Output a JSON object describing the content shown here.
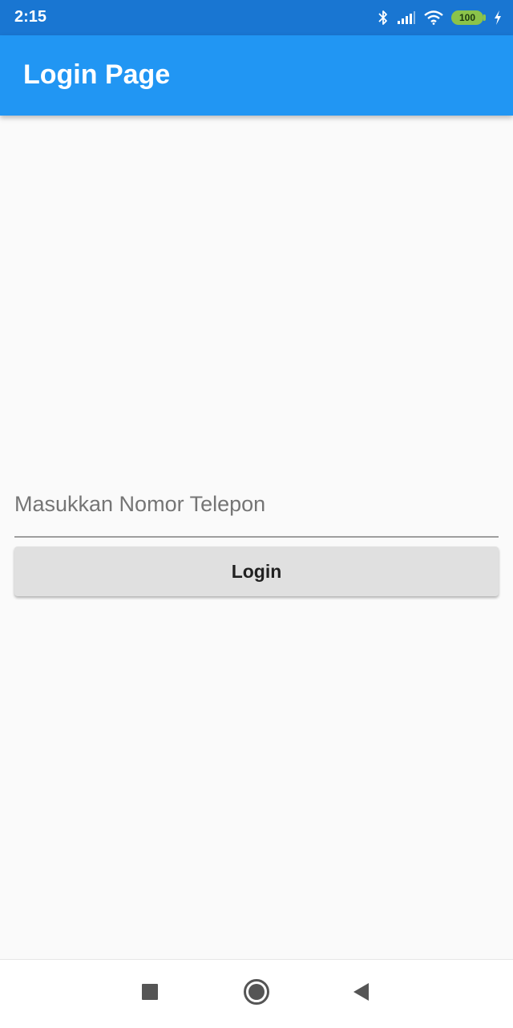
{
  "status_bar": {
    "time": "2:15",
    "battery_level": "100",
    "icons": [
      "bluetooth-icon",
      "signal-icon",
      "wifi-icon",
      "battery-icon",
      "charging-icon"
    ]
  },
  "app_bar": {
    "title": "Login Page",
    "color": "#2196f3"
  },
  "form": {
    "phone_placeholder": "Masukkan Nomor Telepon",
    "phone_value": "",
    "login_label": "Login"
  },
  "nav_bar": {
    "buttons": [
      "recents-icon",
      "home-icon",
      "back-icon"
    ]
  }
}
